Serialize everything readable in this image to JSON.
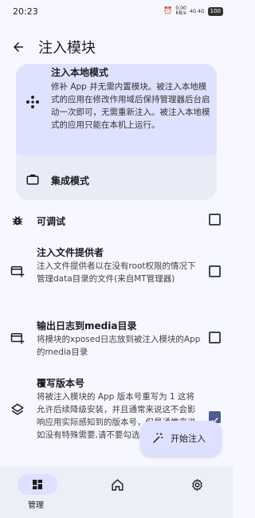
{
  "status_bar": {
    "time": "20:23",
    "net_speed_value": "0.00",
    "net_speed_unit": "KB/s",
    "signal": "4G 4G",
    "battery": "100"
  },
  "app_bar": {
    "title": "注入模块"
  },
  "modes": [
    {
      "title": "注入本地模式",
      "description": "修补 App 并无需内置模块。被注入本地模式的应用在修改作用域后保持管理器后台启动一次即可，无需重新注入。被注入本地模式的应用只能在本机上运行。",
      "selected": true,
      "icon": "diamond-dots-icon"
    },
    {
      "title": "集成模式",
      "selected": false,
      "icon": "briefcase-icon"
    }
  ],
  "settings": [
    {
      "title": "可调试",
      "description": "",
      "checked": false,
      "icon": "bug-icon"
    },
    {
      "title": "注入文件提供者",
      "description": "注入文件提供者以在没有root权限的情况下管理data目录的文件(来自MT管理器)",
      "checked": false,
      "icon": "card-add-icon"
    },
    {
      "title": "输出日志到media目录",
      "description": "将模块的xposed日志放到被注入模块的App的media目录",
      "checked": false,
      "icon": "card-add-icon"
    },
    {
      "title": "覆写版本号",
      "description": "将被注入模块的 App 版本号重写为 1 这将允许后续降级安装，并且通常来说这不会影响应用实际感知到的版本号，但是通常来说,如没有特殊需要,请不要勾选)",
      "checked": true,
      "icon": "layers-icon"
    }
  ],
  "fab": {
    "label": "开始注入",
    "icon": "magic-wand-icon"
  },
  "bottom_nav": [
    {
      "label": "管理",
      "icon": "dashboard-icon",
      "active": true
    },
    {
      "label": "",
      "icon": "home-icon",
      "active": false
    },
    {
      "label": "",
      "icon": "gear-icon",
      "active": false
    }
  ],
  "colors": {
    "background": "#f7f8ff",
    "selected_card": "#dfe2ff",
    "card": "#e9ebf7",
    "accent": "#4c5c92"
  }
}
